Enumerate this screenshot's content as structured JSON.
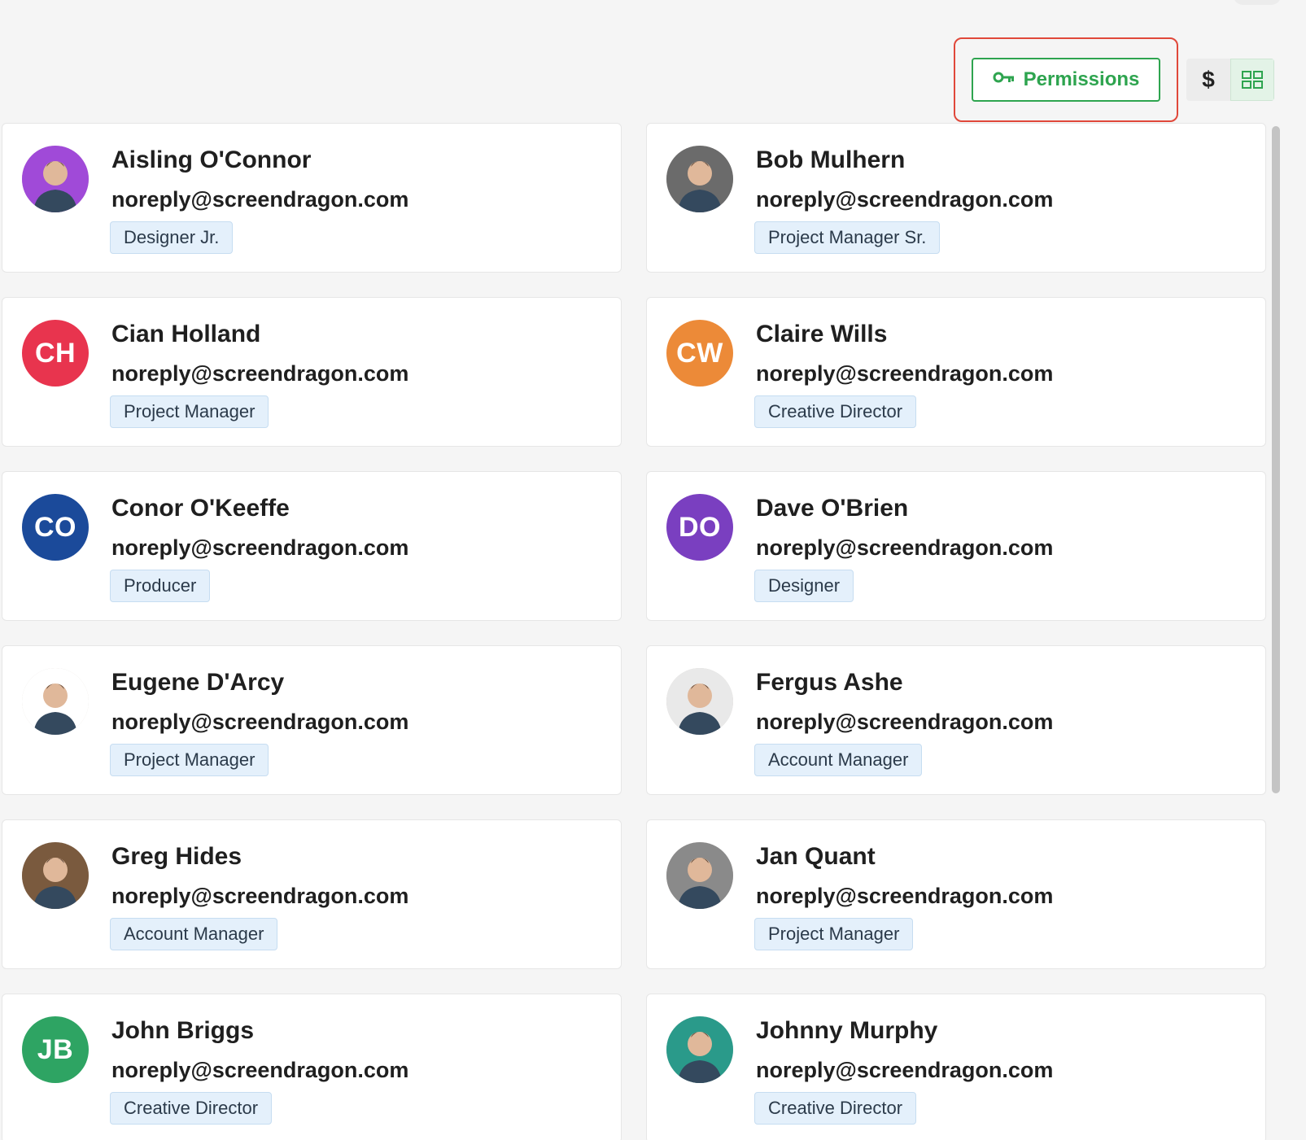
{
  "toolbar": {
    "permissions_label": "Permissions",
    "dollar_label": "$",
    "accent_color": "#2ea44f",
    "highlight_color": "#e0483a",
    "icons": {
      "permissions": "key-icon",
      "grid_view": "grid-icon",
      "cost_view": "dollar-icon"
    }
  },
  "people": [
    {
      "name": "Aisling O'Connor",
      "email": "noreply@screendragon.com",
      "role": "Designer Jr.",
      "avatar": {
        "type": "photo",
        "initials": "",
        "color": "#a04ad8"
      }
    },
    {
      "name": "Bob Mulhern",
      "email": "noreply@screendragon.com",
      "role": "Project Manager Sr.",
      "avatar": {
        "type": "photo",
        "initials": "",
        "color": "#6b6b6b"
      }
    },
    {
      "name": "Cian Holland",
      "email": "noreply@screendragon.com",
      "role": "Project Manager",
      "avatar": {
        "type": "initials",
        "initials": "CH",
        "color": "#e8344e"
      }
    },
    {
      "name": "Claire Wills",
      "email": "noreply@screendragon.com",
      "role": "Creative Director",
      "avatar": {
        "type": "initials",
        "initials": "CW",
        "color": "#ec8a38"
      }
    },
    {
      "name": "Conor O'Keeffe",
      "email": "noreply@screendragon.com",
      "role": "Producer",
      "avatar": {
        "type": "initials",
        "initials": "CO",
        "color": "#1b4a9a"
      }
    },
    {
      "name": "Dave O'Brien",
      "email": "noreply@screendragon.com",
      "role": "Designer",
      "avatar": {
        "type": "initials",
        "initials": "DO",
        "color": "#7a3fc0"
      }
    },
    {
      "name": "Eugene D'Arcy",
      "email": "noreply@screendragon.com",
      "role": "Project Manager",
      "avatar": {
        "type": "photo",
        "initials": "",
        "color": "#ffffff"
      }
    },
    {
      "name": "Fergus Ashe",
      "email": "noreply@screendragon.com",
      "role": "Account Manager",
      "avatar": {
        "type": "photo",
        "initials": "",
        "color": "#e9e9e9"
      }
    },
    {
      "name": "Greg Hides",
      "email": "noreply@screendragon.com",
      "role": "Account Manager",
      "avatar": {
        "type": "photo",
        "initials": "",
        "color": "#7a5a3e"
      }
    },
    {
      "name": "Jan Quant",
      "email": "noreply@screendragon.com",
      "role": "Project Manager",
      "avatar": {
        "type": "photo",
        "initials": "",
        "color": "#8a8a8a"
      }
    },
    {
      "name": "John Briggs",
      "email": "noreply@screendragon.com",
      "role": "Creative Director",
      "avatar": {
        "type": "initials",
        "initials": "JB",
        "color": "#2ea463"
      }
    },
    {
      "name": "Johnny Murphy",
      "email": "noreply@screendragon.com",
      "role": "Creative Director",
      "avatar": {
        "type": "photo",
        "initials": "",
        "color": "#2a9a8a"
      }
    }
  ]
}
